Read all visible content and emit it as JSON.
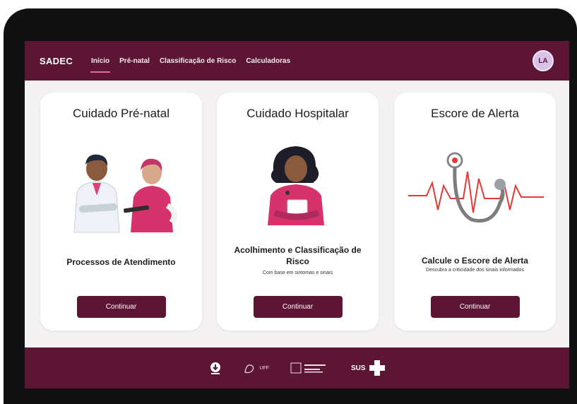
{
  "app": {
    "brand": "SADEC"
  },
  "nav": {
    "items": [
      "Início",
      "Pré-natal",
      "Classificação de Risco",
      "Calculadoras"
    ]
  },
  "user": {
    "initials": "LA"
  },
  "cards": [
    {
      "title": "Cuidado Pré-natal",
      "subtitle": "Processos de Atendimento",
      "description": "",
      "button": "Continuar"
    },
    {
      "title": "Cuidado Hospitalar",
      "subtitle": "Acolhimento e Classificação de Risco",
      "description": "Com base em sintomas e sinais",
      "button": "Continuar"
    },
    {
      "title": "Escore de Alerta",
      "subtitle": "Calcule o Escore de Alerta",
      "description": "Descubra a criticidade dos sinais informados",
      "button": "Continuar"
    }
  ],
  "footer": {
    "logo_uff": "UFF",
    "logo_sus": "SUS"
  },
  "colors": {
    "primary": "#5c1634",
    "accent": "#e56b9c",
    "avatar": "#d9c2e8"
  }
}
